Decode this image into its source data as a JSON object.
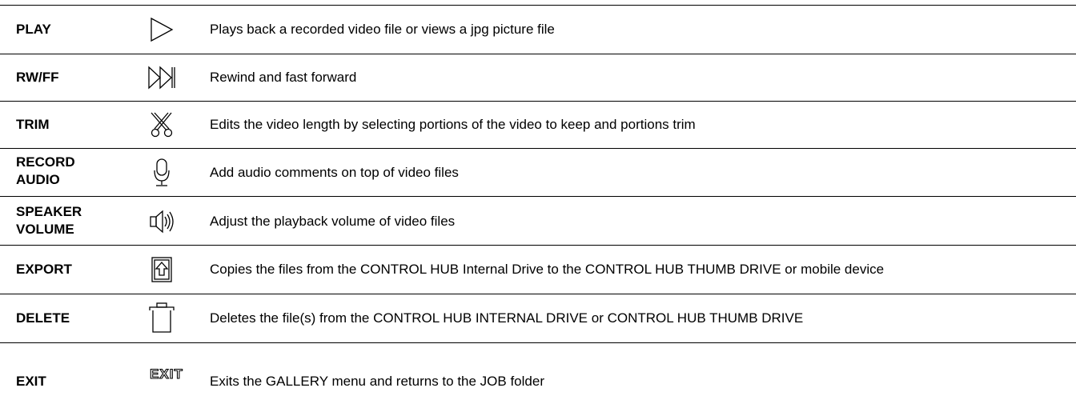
{
  "rows": [
    {
      "label": "PLAY",
      "icon": "play-icon",
      "description": "Plays back a recorded video file or views a jpg picture file"
    },
    {
      "label": "RW/FF",
      "icon": "fast-forward-icon",
      "description": "Rewind and fast forward"
    },
    {
      "label": "TRIM",
      "icon": "scissors-icon",
      "description": "Edits the video length by selecting portions of the video to keep and portions trim"
    },
    {
      "label_line1": "RECORD",
      "label_line2": "AUDIO",
      "icon": "microphone-icon",
      "description": "Add audio comments on top of video files"
    },
    {
      "label_line1": "SPEAKER",
      "label_line2": "VOLUME",
      "icon": "speaker-icon",
      "description": "Adjust the playback volume of video files"
    },
    {
      "label": "EXPORT",
      "icon": "export-icon",
      "description": "Copies the files from the CONTROL HUB Internal Drive to the CONTROL HUB THUMB DRIVE or mobile device"
    },
    {
      "label": "DELETE",
      "icon": "trash-icon",
      "description": "Deletes the file(s) from the CONTROL HUB INTERNAL DRIVE or CONTROL HUB THUMB DRIVE"
    },
    {
      "label": "EXIT",
      "icon": "exit-icon",
      "icon_text": "EXIT",
      "description": "Exits the GALLERY menu and returns to the JOB folder"
    }
  ]
}
